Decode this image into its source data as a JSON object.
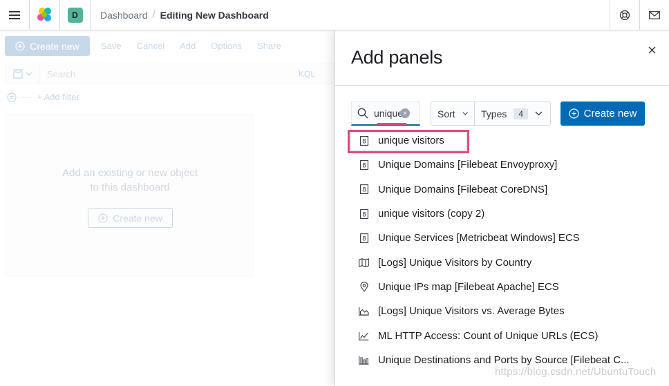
{
  "header": {
    "space_initial": "D",
    "breadcrumbs": [
      "Dashboard",
      "Editing New Dashboard"
    ],
    "breadcrumb_separator": "/"
  },
  "dashboard": {
    "create_new_label": "Create new",
    "top_nav": [
      "Save",
      "Cancel",
      "Add",
      "Options",
      "Share"
    ],
    "search_placeholder": "Search",
    "query_language": "KQL",
    "add_filter_label": "+ Add filter",
    "filter_dash": "—",
    "empty_text_link": "Add an existing",
    "empty_text_rest": " or new object",
    "empty_text_line2": "to this dashboard",
    "empty_create_label": "Create new"
  },
  "flyout": {
    "title": "Add panels",
    "search_value": "unique",
    "sort_label": "Sort",
    "types_label": "Types",
    "types_count": "4",
    "create_new_label": "Create new",
    "accent_color": "#006bb4",
    "highlight_color": "#e0487c",
    "results": [
      {
        "icon": "metric-icon",
        "label": "unique visitors"
      },
      {
        "icon": "metric-icon",
        "label": "Unique Domains [Filebeat Envoyproxy]"
      },
      {
        "icon": "metric-icon",
        "label": "Unique Domains [Filebeat CoreDNS]"
      },
      {
        "icon": "metric-icon",
        "label": "unique visitors (copy 2)"
      },
      {
        "icon": "metric-icon",
        "label": "Unique Services [Metricbeat Windows] ECS"
      },
      {
        "icon": "map-icon",
        "label": "[Logs] Unique Visitors by Country"
      },
      {
        "icon": "map-pin-icon",
        "label": "Unique IPs map [Filebeat Apache] ECS"
      },
      {
        "icon": "area-chart-icon",
        "label": "[Logs] Unique Visitors vs. Average Bytes"
      },
      {
        "icon": "line-chart-icon",
        "label": "ML HTTP Access: Count of Unique URLs (ECS)"
      },
      {
        "icon": "bar-chart-icon",
        "label": "Unique Destinations and Ports by Source [Filebeat C..."
      }
    ]
  },
  "watermark": "https://blog.csdn.net/UbuntuTouch"
}
